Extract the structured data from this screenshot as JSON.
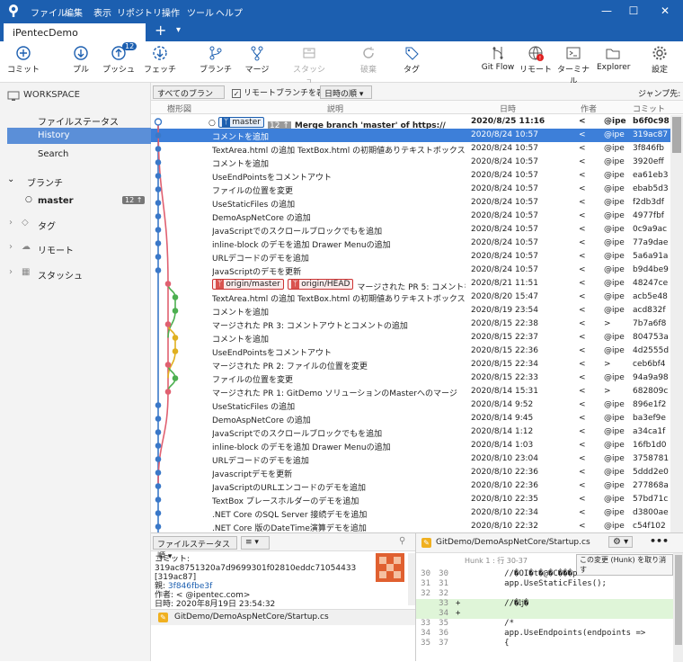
{
  "menu": [
    "ファイル",
    "編集",
    "表示",
    "リポジトリ",
    "操作",
    "ツール",
    "ヘルプ"
  ],
  "tab": {
    "title": "iPentecDemo",
    "add": "+",
    "dropdown": "▾"
  },
  "toolbar": [
    {
      "label": "コミット",
      "icon": "commit-icon"
    },
    {
      "label": "プル",
      "icon": "pull-icon"
    },
    {
      "label": "プッシュ",
      "icon": "push-icon",
      "badge": "12"
    },
    {
      "label": "フェッチ",
      "icon": "fetch-icon"
    },
    {
      "label": "ブランチ",
      "icon": "branch-icon"
    },
    {
      "label": "マージ",
      "icon": "merge-icon"
    },
    {
      "label": "スタッシュ",
      "icon": "stash-icon"
    },
    {
      "label": "破棄",
      "icon": "discard-icon"
    },
    {
      "label": "タグ",
      "icon": "tag-icon"
    },
    {
      "label": "Git Flow",
      "icon": "gitflow-icon"
    },
    {
      "label": "リモート",
      "icon": "remote-icon"
    },
    {
      "label": "ターミナル",
      "icon": "terminal-icon"
    },
    {
      "label": "Explorer",
      "icon": "explorer-icon"
    },
    {
      "label": "設定",
      "icon": "settings-icon"
    }
  ],
  "sidebar": {
    "workspace": "WORKSPACE",
    "file_status": "ファイルステータス",
    "history": "History",
    "search": "Search",
    "branches": "ブランチ",
    "master": "master",
    "master_badge": "12 ↑",
    "tags": "タグ",
    "remotes": "リモート",
    "stashes": "スタッシュ"
  },
  "filter": {
    "branches": "すべてのブランチ ▾",
    "show_remote": "リモートブランチを表示",
    "order": "日時の順 ▾",
    "jump": "ジャンプ先:"
  },
  "columns": {
    "graph": "樹形図",
    "desc": "説明",
    "date": "日時",
    "author": "作者",
    "commit": "コミット"
  },
  "commits": [
    {
      "msg": "Merge branch 'master' of https://",
      "extra": "/Def",
      "date": "2020/8/25 11:16",
      "author": "<",
      "email": "@ipe",
      "id": "b6f0c98",
      "head": true
    },
    {
      "msg": "コメントを追加",
      "date": "2020/8/24 10:57",
      "author": "<",
      "email": "@ipe",
      "id": "319ac87",
      "sel": true
    },
    {
      "msg": "TextArea.html の追加 TextBox.html の初期値ありテキストボックスの追加",
      "date": "2020/8/24 10:57",
      "author": "<",
      "email": "@ipe",
      "id": "3f846fb"
    },
    {
      "msg": "コメントを追加",
      "date": "2020/8/24 10:57",
      "author": "<",
      "email": "@ipe",
      "id": "3920eff"
    },
    {
      "msg": "UseEndPointsをコメントアウト",
      "date": "2020/8/24 10:57",
      "author": "<",
      "email": "@ipe",
      "id": "ea61eb3"
    },
    {
      "msg": "ファイルの位置を変更",
      "date": "2020/8/24 10:57",
      "author": "<",
      "email": "@ipe",
      "id": "ebab5d3"
    },
    {
      "msg": "UseStaticFiles の追加",
      "date": "2020/8/24 10:57",
      "author": "<",
      "email": "@ipe",
      "id": "f2db3df"
    },
    {
      "msg": "DemoAspNetCore の追加",
      "date": "2020/8/24 10:57",
      "author": "<",
      "email": "@ipe",
      "id": "4977fbf"
    },
    {
      "msg": "JavaScriptでのスクロールブロックでもを追加",
      "date": "2020/8/24 10:57",
      "author": "<",
      "email": "@ipe",
      "id": "0c9a9ac"
    },
    {
      "msg": "inline-block のデモを追加 Drawer Menuの追加",
      "date": "2020/8/24 10:57",
      "author": "<",
      "email": "@ipe",
      "id": "77a9dae"
    },
    {
      "msg": "URLデコードのデモを追加",
      "date": "2020/8/24 10:57",
      "author": "<",
      "email": "@ipe",
      "id": "5a6a91a"
    },
    {
      "msg": "JavaScriptのデモを更新",
      "date": "2020/8/24 10:57",
      "author": "<",
      "email": "@ipe",
      "id": "b9d4be9"
    },
    {
      "msg": "マージされた PR 5: コメントを追",
      "labels": [
        "origin/master",
        "origin/HEAD"
      ],
      "date": "2020/8/21 11:51",
      "author": "<",
      "email": "@ipe",
      "id": "48247ce"
    },
    {
      "msg": "TextArea.html の追加 TextBox.html の初期値ありテキストボックスの追加",
      "date": "2020/8/20 15:47",
      "author": "<",
      "email": "@ipe",
      "id": "acb5e48"
    },
    {
      "msg": "コメントを追加",
      "date": "2020/8/19 23:54",
      "author": "<",
      "email": "@ipe",
      "id": "acd832f"
    },
    {
      "msg": "マージされた PR 3: コメントアウトとコメントの追加",
      "date": "2020/8/15 22:38",
      "author": "<",
      "email": ">",
      "id": "7b7a6f8"
    },
    {
      "msg": "コメントを追加",
      "date": "2020/8/15 22:37",
      "author": "<",
      "email": "@ipe",
      "id": "804753a"
    },
    {
      "msg": "UseEndPointsをコメントアウト",
      "date": "2020/8/15 22:36",
      "author": "<",
      "email": "@ipe",
      "id": "4d2555d"
    },
    {
      "msg": "マージされた PR 2: ファイルの位置を変更",
      "date": "2020/8/15 22:34",
      "author": "<",
      "email": ">",
      "id": "ceb6bf4"
    },
    {
      "msg": "ファイルの位置を変更",
      "date": "2020/8/15 22:33",
      "author": "<",
      "email": "@ipe",
      "id": "94a9a98"
    },
    {
      "msg": "マージされた PR 1: GitDemo ソリューションのMasterへのマージ",
      "date": "2020/8/14 15:31",
      "author": "<",
      "email": ">",
      "id": "682809c"
    },
    {
      "msg": "UseStaticFiles の追加",
      "date": "2020/8/14 9:52",
      "author": "<",
      "email": "@ipe",
      "id": "896e1f2"
    },
    {
      "msg": "DemoAspNetCore の追加",
      "date": "2020/8/14 9:45",
      "author": "<",
      "email": "@ipe",
      "id": "ba3ef9e"
    },
    {
      "msg": "JavaScriptでのスクロールブロックでもを追加",
      "date": "2020/8/14 1:12",
      "author": "<",
      "email": "@ipe",
      "id": "a34ca1f"
    },
    {
      "msg": "inline-block のデモを追加 Drawer Menuの追加",
      "date": "2020/8/14 1:03",
      "author": "<",
      "email": "@ipe",
      "id": "16fb1d0"
    },
    {
      "msg": "URLデコードのデモを追加",
      "date": "2020/8/10 23:04",
      "author": "<",
      "email": "@ipe",
      "id": "3758781"
    },
    {
      "msg": "Javascriptデモを更新",
      "date": "2020/8/10 22:36",
      "author": "<",
      "email": "@ipe",
      "id": "5ddd2e0"
    },
    {
      "msg": "JavaScriptのURLエンコードのデモを追加",
      "date": "2020/8/10 22:36",
      "author": "<",
      "email": "@ipe",
      "id": "277868a"
    },
    {
      "msg": "TextBox プレースホルダーのデモを追加",
      "date": "2020/8/10 22:35",
      "author": "<",
      "email": "@ipe",
      "id": "57bd71c"
    },
    {
      "msg": ".NET Core のSQL Server 接続デモを追加",
      "date": "2020/8/10 22:34",
      "author": "<",
      "email": "@ipe",
      "id": "d3800ae"
    },
    {
      "msg": ".NET Core 版のDateTime演算デモを追加",
      "date": "2020/8/10 22:32",
      "author": "<",
      "email": "@ipe",
      "id": "c54f102"
    }
  ],
  "head_branch": "master",
  "head_badge": "12 ↑",
  "details": {
    "sort": "ファイルステータス順 ▾",
    "view": "≡ ▾",
    "commit_label": "コミット:",
    "commit_hash": "319ac8751320a7d9699301f02810eddc71054433",
    "commit_short": "[319ac87]",
    "parent_label": "親:",
    "parent": "3f846fbe3f",
    "author_label": "作者:",
    "author": "<          @ipentec.com>",
    "date_label": "日時:",
    "date": "2020年8月19日 23:54:32",
    "file": "GitDemo/DemoAspNetCore/Startup.cs"
  },
  "diff": {
    "path": "GitDemo/DemoAspNetCore/Startup.cs",
    "hunk": "Hunk 1 : 行 30-37",
    "discard": "この変更 (Hunk) を取り消す",
    "lines": [
      {
        "o": "30",
        "n": "30",
        "t": "          //�OI�t�@�C���p",
        "k": "ctx"
      },
      {
        "o": "31",
        "n": "31",
        "t": "          app.UseStaticFiles();",
        "k": "ctx"
      },
      {
        "o": "32",
        "n": "32",
        "t": "",
        "k": "ctx"
      },
      {
        "o": "",
        "n": "33",
        "t": "+         //�ǉ�",
        "k": "add"
      },
      {
        "o": "",
        "n": "34",
        "t": "+",
        "k": "add"
      },
      {
        "o": "33",
        "n": "35",
        "t": "          /*",
        "k": "ctx"
      },
      {
        "o": "34",
        "n": "36",
        "t": "          app.UseEndpoints(endpoints =>",
        "k": "ctx"
      },
      {
        "o": "35",
        "n": "37",
        "t": "          {",
        "k": "ctx"
      }
    ]
  },
  "colors": {
    "accent": "#1c5fb0",
    "selection": "#3d7fd9",
    "graph_blue": "#3a78c8",
    "graph_red": "#e06070",
    "graph_green": "#4caf50",
    "graph_yellow": "#e0b020"
  }
}
